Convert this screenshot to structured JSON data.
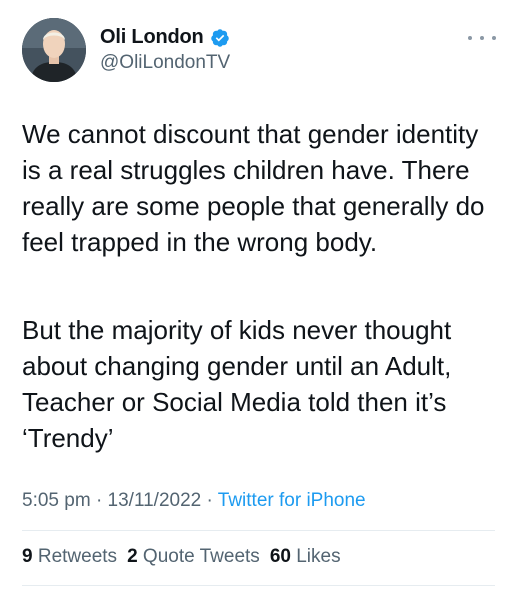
{
  "author": {
    "display_name": "Oli London",
    "handle": "@OliLondonTV",
    "avatar_icon": "profile-photo",
    "verified_icon": "verified-badge-icon",
    "verified_color": "#1d9bf0"
  },
  "tweet": {
    "paragraph_1": "We cannot discount that gender identity is a real struggles children have. There really are some people that generally do feel trapped in the wrong body.",
    "paragraph_2": "But the majority of kids never thought about changing gender until an Adult, Teacher or Social Media told then it’s ‘Trendy’"
  },
  "meta": {
    "time": "5:05 pm",
    "separator": "·",
    "date": "13/11/2022",
    "source": "Twitter for iPhone"
  },
  "stats": {
    "retweets_count": "9",
    "retweets_label": "Retweets",
    "quotes_count": "2",
    "quotes_label": "Quote Tweets",
    "likes_count": "60",
    "likes_label": "Likes"
  },
  "colors": {
    "text": "#0f1419",
    "secondary": "#536471",
    "link": "#1d9bf0",
    "divider": "#e6ecf0"
  }
}
